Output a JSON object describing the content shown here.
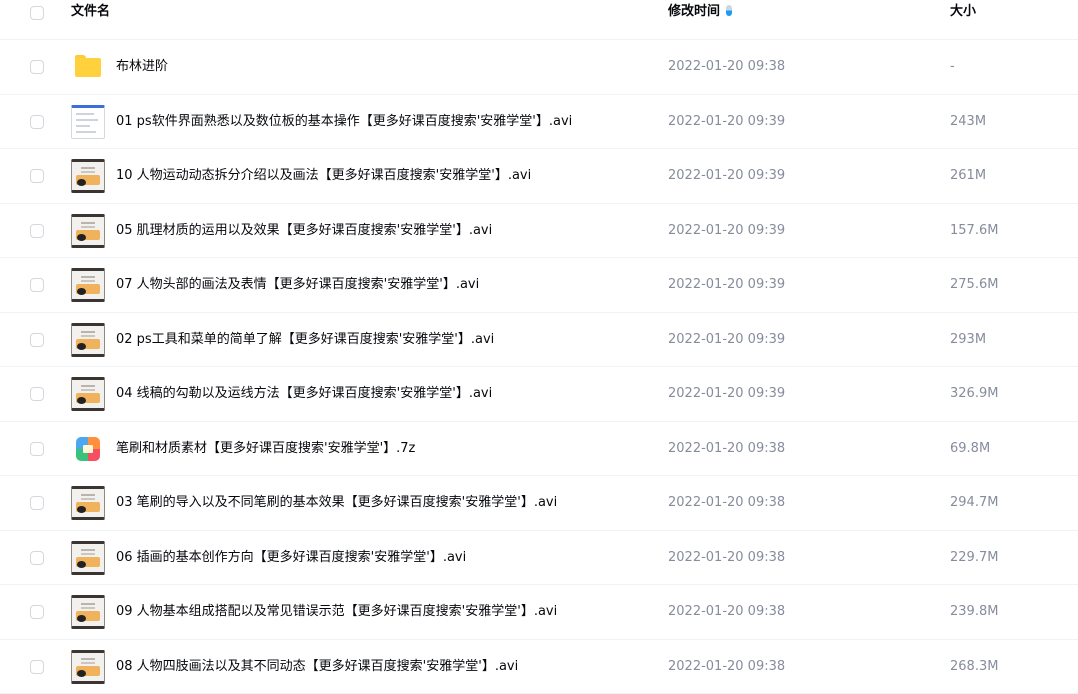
{
  "header": {
    "name_label": "文件名",
    "time_label": "修改时间",
    "size_label": "大小",
    "sort_icon": "sort-descending-icon"
  },
  "files": [
    {
      "icon": "folder-icon",
      "name": "布林进阶",
      "time": "2022-01-20 09:38",
      "size": "-"
    },
    {
      "icon": "video-thumbnail-icon",
      "name": "01 ps软件界面熟悉以及数位板的基本操作【更多好课百度搜索'安雅学堂'】.avi",
      "time": "2022-01-20 09:39",
      "size": "243M"
    },
    {
      "icon": "video-thumbnail-icon",
      "name": "10 人物运动动态拆分介绍以及画法【更多好课百度搜索'安雅学堂'】.avi",
      "time": "2022-01-20 09:39",
      "size": "261M"
    },
    {
      "icon": "video-thumbnail-icon",
      "name": "05 肌理材质的运用以及效果【更多好课百度搜索'安雅学堂'】.avi",
      "time": "2022-01-20 09:39",
      "size": "157.6M"
    },
    {
      "icon": "video-thumbnail-icon",
      "name": "07 人物头部的画法及表情【更多好课百度搜索'安雅学堂'】.avi",
      "time": "2022-01-20 09:39",
      "size": "275.6M"
    },
    {
      "icon": "video-thumbnail-icon",
      "name": "02 ps工具和菜单的简单了解【更多好课百度搜索'安雅学堂'】.avi",
      "time": "2022-01-20 09:39",
      "size": "293M"
    },
    {
      "icon": "video-thumbnail-icon",
      "name": "04 线稿的勾勒以及运线方法【更多好课百度搜索'安雅学堂'】.avi",
      "time": "2022-01-20 09:39",
      "size": "326.9M"
    },
    {
      "icon": "archive-icon",
      "name": "笔刷和材质素材【更多好课百度搜索'安雅学堂'】.7z",
      "time": "2022-01-20 09:38",
      "size": "69.8M"
    },
    {
      "icon": "video-thumbnail-icon",
      "name": "03 笔刷的导入以及不同笔刷的基本效果【更多好课百度搜索'安雅学堂'】.avi",
      "time": "2022-01-20 09:38",
      "size": "294.7M"
    },
    {
      "icon": "video-thumbnail-icon",
      "name": "06 插画的基本创作方向【更多好课百度搜索'安雅学堂'】.avi",
      "time": "2022-01-20 09:38",
      "size": "229.7M"
    },
    {
      "icon": "video-thumbnail-icon",
      "name": "09 人物基本组成搭配以及常见错误示范【更多好课百度搜索'安雅学堂'】.avi",
      "time": "2022-01-20 09:38",
      "size": "239.8M"
    },
    {
      "icon": "video-thumbnail-icon",
      "name": "08 人物四肢画法以及其不同动态【更多好课百度搜索'安雅学堂'】.avi",
      "time": "2022-01-20 09:38",
      "size": "268.3M"
    }
  ],
  "colors": {
    "text_primary": "#06080d",
    "text_secondary": "#878c9c",
    "folder": "#ffd13d",
    "sort_accent": "#1e9bf0"
  }
}
